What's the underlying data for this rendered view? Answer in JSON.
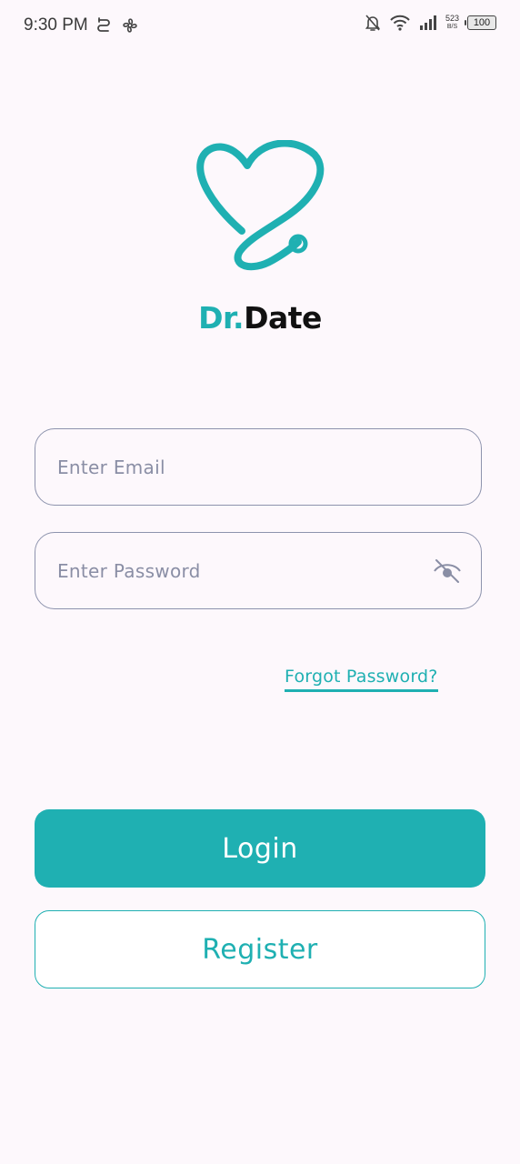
{
  "status_bar": {
    "time": "9:30 PM",
    "net_speed_value": "523",
    "net_speed_unit": "B/S",
    "battery": "100"
  },
  "brand": {
    "prefix": "Dr.",
    "suffix": "Date"
  },
  "form": {
    "email_placeholder": "Enter Email",
    "email_value": "",
    "password_placeholder": "Enter Password",
    "password_value": "",
    "forgot_password": "Forgot Password?"
  },
  "actions": {
    "login": "Login",
    "register": "Register"
  },
  "colors": {
    "accent": "#1fb0b2",
    "background": "#fdf8fc",
    "field_border": "#8d93ad",
    "placeholder": "#8a8ea5"
  },
  "icons": {
    "logo": "heart-stethoscope-icon",
    "password_toggle": "eye-off-icon",
    "status_left": [
      "sync-icon",
      "fan-icon"
    ],
    "status_right": [
      "bell-off-icon",
      "wifi-icon",
      "signal-icon",
      "battery-icon"
    ]
  }
}
